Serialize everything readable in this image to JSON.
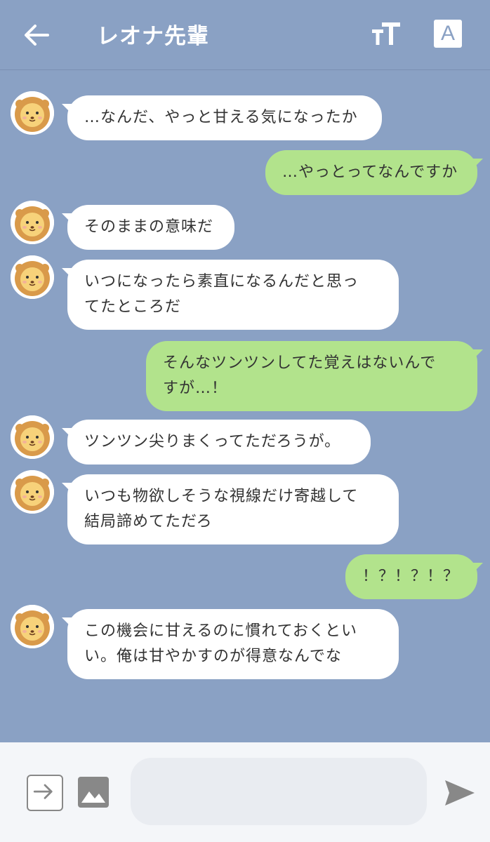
{
  "header": {
    "title": "レオナ先輩",
    "translate_label": "A"
  },
  "messages": [
    {
      "side": "left",
      "lines": [
        "…なんだ、やっと甘える気になったか"
      ]
    },
    {
      "side": "right",
      "lines": [
        "…やっとってなんですか"
      ]
    },
    {
      "side": "left",
      "lines": [
        "そのままの意味だ"
      ]
    },
    {
      "side": "left",
      "lines": [
        "いつになったら素直になるんだと思っ",
        "てたところだ"
      ]
    },
    {
      "side": "right",
      "lines": [
        "そんなツンツンしてた覚えはないんで",
        "すが…！"
      ]
    },
    {
      "side": "left",
      "lines": [
        "ツンツン尖りまくってただろうが。"
      ]
    },
    {
      "side": "left",
      "lines": [
        "いつも物欲しそうな視線だけ寄越して",
        "結局諦めてただろ"
      ]
    },
    {
      "side": "right",
      "lines": [
        "！？！？！？"
      ]
    },
    {
      "side": "left",
      "lines": [
        "この機会に甘えるのに慣れておくとい",
        "い。俺は甘やかすのが得意なんでな"
      ]
    }
  ],
  "footer": {
    "input_value": ""
  },
  "colors": {
    "background": "#8aa1c4",
    "incoming_bubble": "#ffffff",
    "outgoing_bubble": "#b2e38c"
  }
}
